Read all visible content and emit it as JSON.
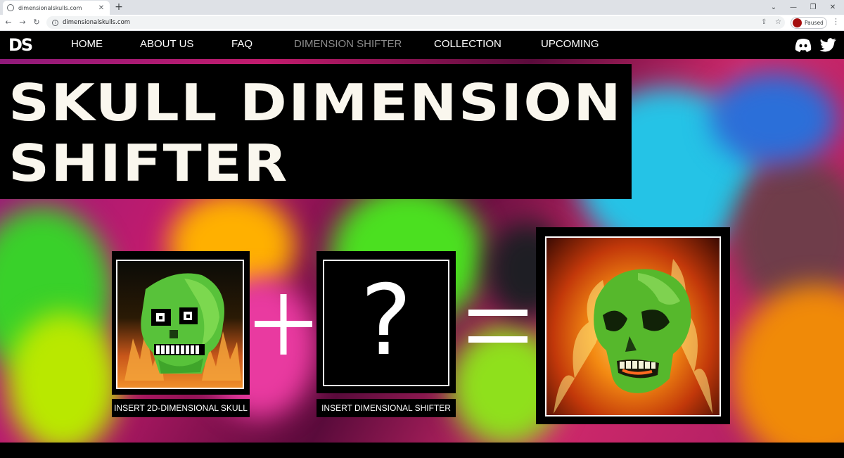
{
  "browser": {
    "tab_title": "dimensionalskulls.com",
    "url": "dimensionalskulls.com",
    "profile_status": "Paused"
  },
  "site": {
    "logo": "DS",
    "nav": [
      {
        "label": "HOME"
      },
      {
        "label": "ABOUT US"
      },
      {
        "label": "FAQ"
      },
      {
        "label": "DIMENSION SHIFTER",
        "active": true
      },
      {
        "label": "COLLECTION"
      },
      {
        "label": "UPCOMING"
      }
    ]
  },
  "hero": {
    "title_line1": "SKULL DIMENSION",
    "title_line2": "SHIFTER"
  },
  "equation": {
    "plus": "+",
    "equals": "=",
    "question": "?",
    "label_skull": "INSERT 2D-DIMENSIONAL SKULL",
    "label_shifter": "INSERT DIMENSIONAL SHIFTER"
  },
  "icons": {
    "discord": "discord-icon",
    "twitter": "twitter-icon"
  }
}
